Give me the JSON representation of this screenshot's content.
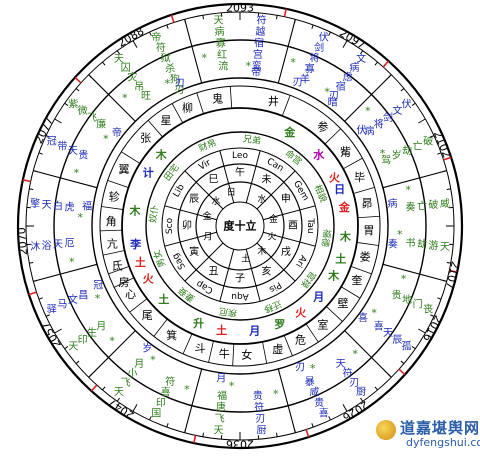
{
  "chart_wheel": {
    "years": [
      {
        "label": "2093",
        "deg": 0
      },
      {
        "label": "2097",
        "deg": 31
      },
      {
        "label": "2102",
        "deg": 68
      },
      {
        "label": "2107",
        "deg": 103
      },
      {
        "label": "2016",
        "deg": 118
      },
      {
        "label": "2026",
        "deg": 148
      },
      {
        "label": "2036",
        "deg": 180
      },
      {
        "label": "2047",
        "deg": 213
      },
      {
        "label": "2057",
        "deg": 240
      },
      {
        "label": "2070",
        "deg": 266
      },
      {
        "label": "2077",
        "deg": 296
      },
      {
        "label": "2088",
        "deg": 330
      }
    ],
    "mansions": [
      {
        "t": "鬼",
        "deg": 350
      },
      {
        "t": "井",
        "deg": 15
      },
      {
        "t": "参",
        "deg": 40
      },
      {
        "t": "觜",
        "deg": 55
      },
      {
        "t": "毕",
        "deg": 68
      },
      {
        "t": "昴",
        "deg": 80
      },
      {
        "t": "胃",
        "deg": 92
      },
      {
        "t": "娄",
        "deg": 104
      },
      {
        "t": "奎",
        "deg": 115
      },
      {
        "t": "壁",
        "deg": 127
      },
      {
        "t": "室",
        "deg": 140
      },
      {
        "t": "危",
        "deg": 152
      },
      {
        "t": "虚",
        "deg": 163
      },
      {
        "t": "女",
        "deg": 177
      },
      {
        "t": "牛",
        "deg": 187
      },
      {
        "t": "斗",
        "deg": 198
      },
      {
        "t": "箕",
        "deg": 212
      },
      {
        "t": "尾",
        "deg": 226
      },
      {
        "t": "心",
        "deg": 238
      },
      {
        "t": "房",
        "deg": 244
      },
      {
        "t": "氐",
        "deg": 252
      },
      {
        "t": "亢",
        "deg": 262
      },
      {
        "t": "角",
        "deg": 272
      },
      {
        "t": "轸",
        "deg": 283
      },
      {
        "t": "翼",
        "deg": 296
      },
      {
        "t": "张",
        "deg": 313
      },
      {
        "t": "星",
        "deg": 325
      },
      {
        "t": "柳",
        "deg": 336
      }
    ],
    "planets": [
      {
        "t": "金",
        "deg": 28,
        "color": "#2e7d1a"
      },
      {
        "t": "水",
        "deg": 48,
        "color": "#b000b0"
      },
      {
        "t": "火",
        "deg": 63,
        "color": "#e02020"
      },
      {
        "t": "日",
        "deg": 70,
        "color": "#1c2ab8"
      },
      {
        "t": "金",
        "deg": 80,
        "color": "#e02020"
      },
      {
        "t": "木",
        "deg": 96,
        "color": "#2e7d1a"
      },
      {
        "t": "土",
        "deg": 108,
        "color": "#2e7d1a"
      },
      {
        "t": "木",
        "deg": 118,
        "color": "#2e7d1a"
      },
      {
        "t": "月",
        "deg": 132,
        "color": "#1c2ab8"
      },
      {
        "t": "火",
        "deg": 145,
        "color": "#e02020"
      },
      {
        "t": "罗",
        "deg": 158,
        "color": "#2e7d1a"
      },
      {
        "t": "月",
        "deg": 172,
        "color": "#1c2ab8"
      },
      {
        "t": "土",
        "deg": 190,
        "color": "#e02020"
      },
      {
        "t": "升",
        "deg": 203,
        "color": "#2e7d1a"
      },
      {
        "t": "土",
        "deg": 226,
        "color": "#2e7d1a"
      },
      {
        "t": "火",
        "deg": 240,
        "color": "#e02020"
      },
      {
        "t": "土",
        "deg": 250,
        "color": "#e02020"
      },
      {
        "t": "李",
        "deg": 260,
        "color": "#1c2ab8"
      },
      {
        "t": "木",
        "deg": 278,
        "color": "#2e7d1a"
      },
      {
        "t": "计",
        "deg": 300,
        "color": "#1c2ab8"
      },
      {
        "t": "木",
        "deg": 312,
        "color": "#2e7d1a"
      }
    ],
    "palaces": [
      {
        "t": "兄弟",
        "deg": 8
      },
      {
        "t": "命宫",
        "deg": 38
      },
      {
        "t": "相貌",
        "deg": 68
      },
      {
        "t": "福德",
        "deg": 98
      },
      {
        "t": "官禄",
        "deg": 128
      },
      {
        "t": "迁移",
        "deg": 158
      },
      {
        "t": "疾厄",
        "deg": 188
      },
      {
        "t": "妻妾",
        "deg": 218
      },
      {
        "t": "男女",
        "deg": 248
      },
      {
        "t": "奴仆",
        "deg": 278
      },
      {
        "t": "田宅",
        "deg": 308
      },
      {
        "t": "财帛",
        "deg": 338
      }
    ],
    "signs": [
      {
        "t": "Leo",
        "deg": 0
      },
      {
        "t": "Can",
        "deg": 30
      },
      {
        "t": "Gem",
        "deg": 60
      },
      {
        "t": "Tau",
        "deg": 90
      },
      {
        "t": "Ari",
        "deg": 120
      },
      {
        "t": "Pis",
        "deg": 150
      },
      {
        "t": "Aqu",
        "deg": 180
      },
      {
        "t": "Cap",
        "deg": 210
      },
      {
        "t": "Sag",
        "deg": 240
      },
      {
        "t": "Sco",
        "deg": 270
      },
      {
        "t": "Lib",
        "deg": 300
      },
      {
        "t": "Vir",
        "deg": 330
      }
    ],
    "branches": [
      {
        "t": "午",
        "deg": 0
      },
      {
        "t": "未",
        "deg": 30
      },
      {
        "t": "申",
        "deg": 60
      },
      {
        "t": "酉",
        "deg": 90
      },
      {
        "t": "戌",
        "deg": 120
      },
      {
        "t": "亥",
        "deg": 150
      },
      {
        "t": "子",
        "deg": 180
      },
      {
        "t": "丑",
        "deg": 210
      },
      {
        "t": "寅",
        "deg": 240
      },
      {
        "t": "卯",
        "deg": 270
      },
      {
        "t": "辰",
        "deg": 300
      },
      {
        "t": "巳",
        "deg": 330
      }
    ],
    "hub_planets": [
      {
        "t": "日",
        "deg": 345
      },
      {
        "t": "水",
        "deg": 40
      },
      {
        "t": "金",
        "deg": 80
      },
      {
        "t": "火",
        "deg": 110
      },
      {
        "t": "木",
        "deg": 140
      },
      {
        "t": "土",
        "deg": 170
      },
      {
        "t": "月",
        "deg": 250
      },
      {
        "t": "金",
        "deg": 285
      },
      {
        "t": "水",
        "deg": 315
      }
    ],
    "center": "度十立",
    "outer_sectors": [
      {
        "deg": 0,
        "a": "天病寡红流",
        "b": "符越宿宫鸾"
      },
      {
        "deg": 30,
        "a": "伏剑将寡羊",
        "b": "文病虑宿刃"
      },
      {
        "deg": 60,
        "a": "伏文剑将病",
        "b": "破亡劫岁驾"
      },
      {
        "deg": 90,
        "a": "威破亡奏",
        "b": "天游劫书"
      },
      {
        "deg": 120,
        "a": "丧门地贵",
        "b": "孤辰天喜"
      },
      {
        "deg": 150,
        "a": "厨刃符天",
        "b": "喜贵咸暴"
      },
      {
        "deg": 180,
        "a": "厨刃符贵",
        "b": "天飞唐福"
      },
      {
        "deg": 210,
        "a": "国印喜符",
        "b": "天飞小月"
      },
      {
        "deg": 240,
        "a": "天印生月",
        "b": "驿马文昌"
      },
      {
        "deg": 270,
        "a": "沐浴天厄",
        "b": "擎天白虎"
      },
      {
        "deg": 300,
        "a": "冠带天贵",
        "b": "紫微飞廉"
      },
      {
        "deg": 330,
        "a": "天囚灾吊旺",
        "b": "帝符狱杀狗刃"
      }
    ],
    "ring_marks": [
      {
        "t": "帝",
        "deg": 6
      },
      {
        "t": "刃",
        "deg": 22
      },
      {
        "t": "暗",
        "deg": 37
      },
      {
        "t": "伏",
        "deg": 52
      },
      {
        "t": "病",
        "deg": 82
      },
      {
        "t": "奏",
        "deg": 97
      },
      {
        "t": "喜",
        "deg": 127
      },
      {
        "t": "刃",
        "deg": 157
      },
      {
        "t": "月",
        "deg": 187
      },
      {
        "t": "岁",
        "deg": 217
      },
      {
        "t": "冠",
        "deg": 247
      },
      {
        "t": "福",
        "deg": 277
      },
      {
        "t": "帝",
        "deg": 307
      },
      {
        "t": "刃",
        "deg": 337
      }
    ]
  },
  "brand": {
    "name": "道嘉堪舆网",
    "url": "dyfengshui.com"
  }
}
